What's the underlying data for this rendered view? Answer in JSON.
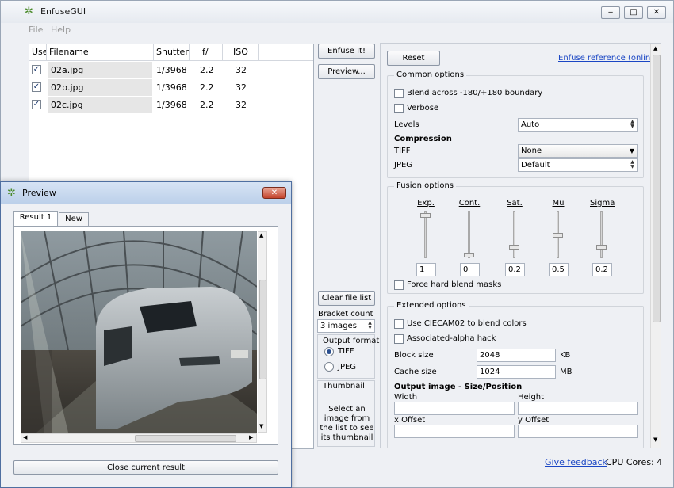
{
  "app": {
    "title": "EnfuseGUI"
  },
  "menu": [
    "File",
    "Help"
  ],
  "titlebar_buttons": {
    "minimize": "‒",
    "maximize": "□",
    "close": "✕"
  },
  "table": {
    "headers": [
      "Use",
      "Filename",
      "Shutter",
      "f/",
      "ISO"
    ],
    "rows": [
      {
        "use": true,
        "filename": "02a.jpg",
        "shutter": "1/3968",
        "f": "2.2",
        "iso": "32"
      },
      {
        "use": true,
        "filename": "02b.jpg",
        "shutter": "1/3968",
        "f": "2.2",
        "iso": "32"
      },
      {
        "use": true,
        "filename": "02c.jpg",
        "shutter": "1/3968",
        "f": "2.2",
        "iso": "32"
      }
    ]
  },
  "middle": {
    "enfuse": "Enfuse It!",
    "preview": "Preview...",
    "clear": "Clear file list",
    "bracket_label": "Bracket count",
    "bracket_value": "3 images",
    "output_format_label": "Output format",
    "tiff": "TIFF",
    "jpeg": "JPEG",
    "output_format_selected": "TIFF",
    "thumbnail_label": "Thumbnail",
    "thumbnail_text": "Select an image from the list to see its thumbnail"
  },
  "options": {
    "reset": "Reset",
    "reference_link": "Enfuse reference (online)",
    "common": {
      "title": "Common options",
      "blend": "Blend across -180/+180 boundary",
      "verbose": "Verbose",
      "levels_label": "Levels",
      "levels_value": "Auto",
      "compression": "Compression",
      "tiff_label": "TIFF",
      "tiff_value": "None",
      "jpeg_label": "JPEG",
      "jpeg_value": "Default"
    },
    "fusion": {
      "title": "Fusion options",
      "sliders": [
        {
          "label": "Exp.",
          "value": "1"
        },
        {
          "label": "Cont.",
          "value": "0"
        },
        {
          "label": "Sat.",
          "value": "0.2"
        },
        {
          "label": "Mu",
          "value": "0.5"
        },
        {
          "label": "Sigma",
          "value": "0.2"
        }
      ],
      "force_hard": "Force hard blend masks"
    },
    "extended": {
      "title": "Extended options",
      "ciecam": "Use CIECAM02 to blend colors",
      "alpha": "Associated-alpha hack",
      "block_label": "Block size",
      "block_value": "2048",
      "block_unit": "KB",
      "cache_label": "Cache size",
      "cache_value": "1024",
      "cache_unit": "MB",
      "output_image": "Output image - Size/Position",
      "width": "Width",
      "height": "Height",
      "xoffset": "x Offset",
      "yoffset": "y Offset"
    }
  },
  "status": {
    "feedback": "Give feedback",
    "cpu": "CPU Cores: 4"
  },
  "preview_window": {
    "title": "Preview",
    "tabs": [
      "Result 1",
      "New"
    ],
    "close_result": "Close current result"
  }
}
